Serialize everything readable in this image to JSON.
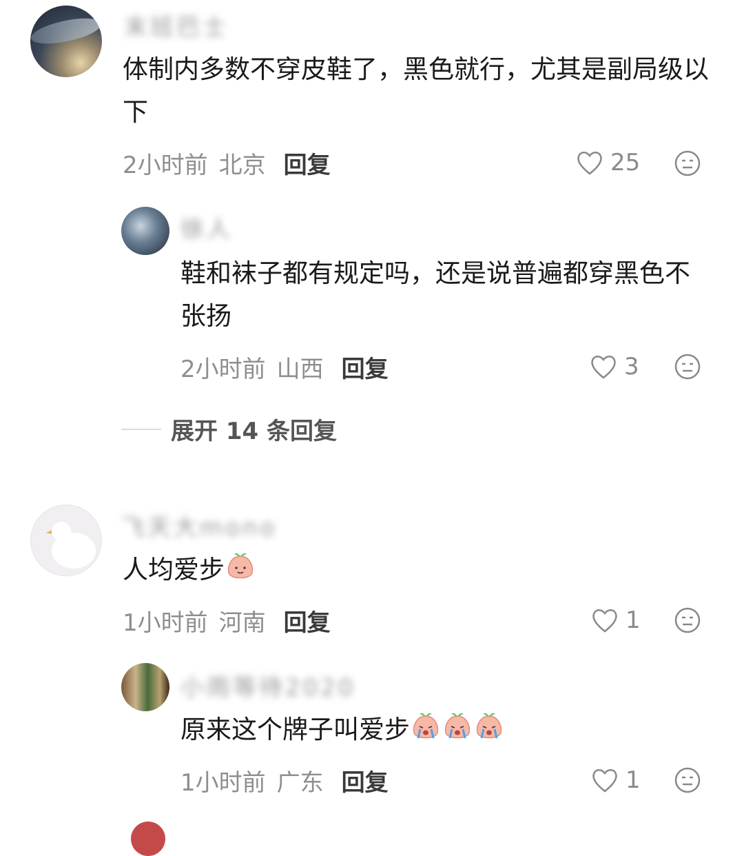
{
  "comments": [
    {
      "username": "末班巴士",
      "text": "体制内多数不穿皮鞋了，黑色就行，尤其是副局级以下",
      "time": "2小时前",
      "location": "北京",
      "reply_label": "回复",
      "likes": "25"
    },
    {
      "username": "徐人",
      "text": "鞋和袜子都有规定吗，还是说普遍都穿黑色不张扬",
      "time": "2小时前",
      "location": "山西",
      "reply_label": "回复",
      "likes": "3"
    },
    {
      "username": "飞天大mono",
      "text": "人均爱步",
      "time": "1小时前",
      "location": "河南",
      "reply_label": "回复",
      "likes": "1"
    },
    {
      "username": "小雨等待2020",
      "text": "原来这个牌子叫爱步",
      "time": "1小时前",
      "location": "广东",
      "reply_label": "回复",
      "likes": "1"
    }
  ],
  "expand": {
    "label": "展开 14 条回复"
  },
  "icons": {
    "like": "heart-outline-icon",
    "more": "neutral-face-icon",
    "emoji_smile": "peach-smile-emoji",
    "emoji_cry": "peach-crying-emoji"
  },
  "colors": {
    "text": "#1a1a1a",
    "meta": "#8e8e8e",
    "peach": "#f7b8a8"
  }
}
